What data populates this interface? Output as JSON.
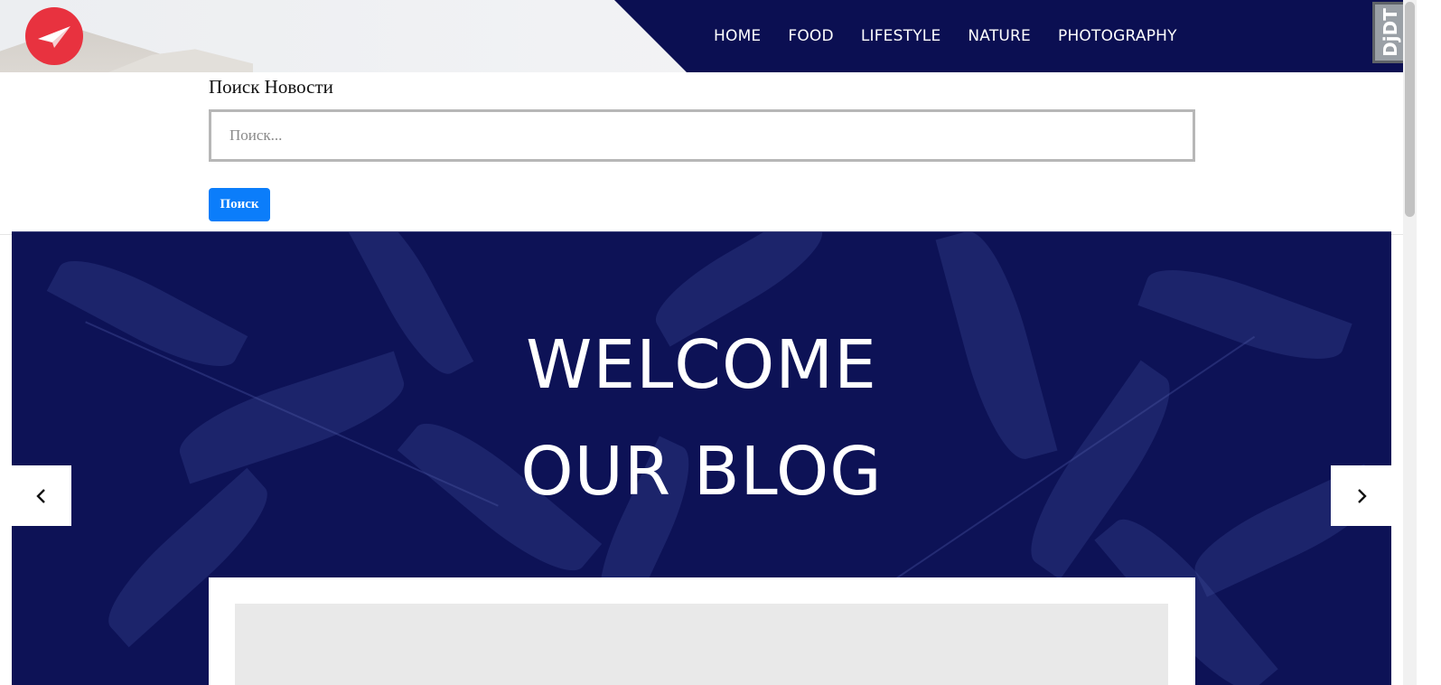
{
  "header": {
    "logo_icon": "paper-plane-icon",
    "nav": [
      "HOME",
      "FOOD",
      "LIFESTYLE",
      "NATURE",
      "PHOTOGRAPHY"
    ],
    "extension_badge": "DjDT"
  },
  "search": {
    "title": "Поиск Новости",
    "placeholder": "Поиск...",
    "value": "",
    "button_label": "Поиск"
  },
  "hero": {
    "title_line1": "WELCOME",
    "title_line2": "OUR BLOG",
    "prev_icon": "chevron-left-icon",
    "next_icon": "chevron-right-icon"
  },
  "colors": {
    "navy": "#0b0f52",
    "accent_red": "#e8323f",
    "button_blue": "#0b7dfa"
  }
}
